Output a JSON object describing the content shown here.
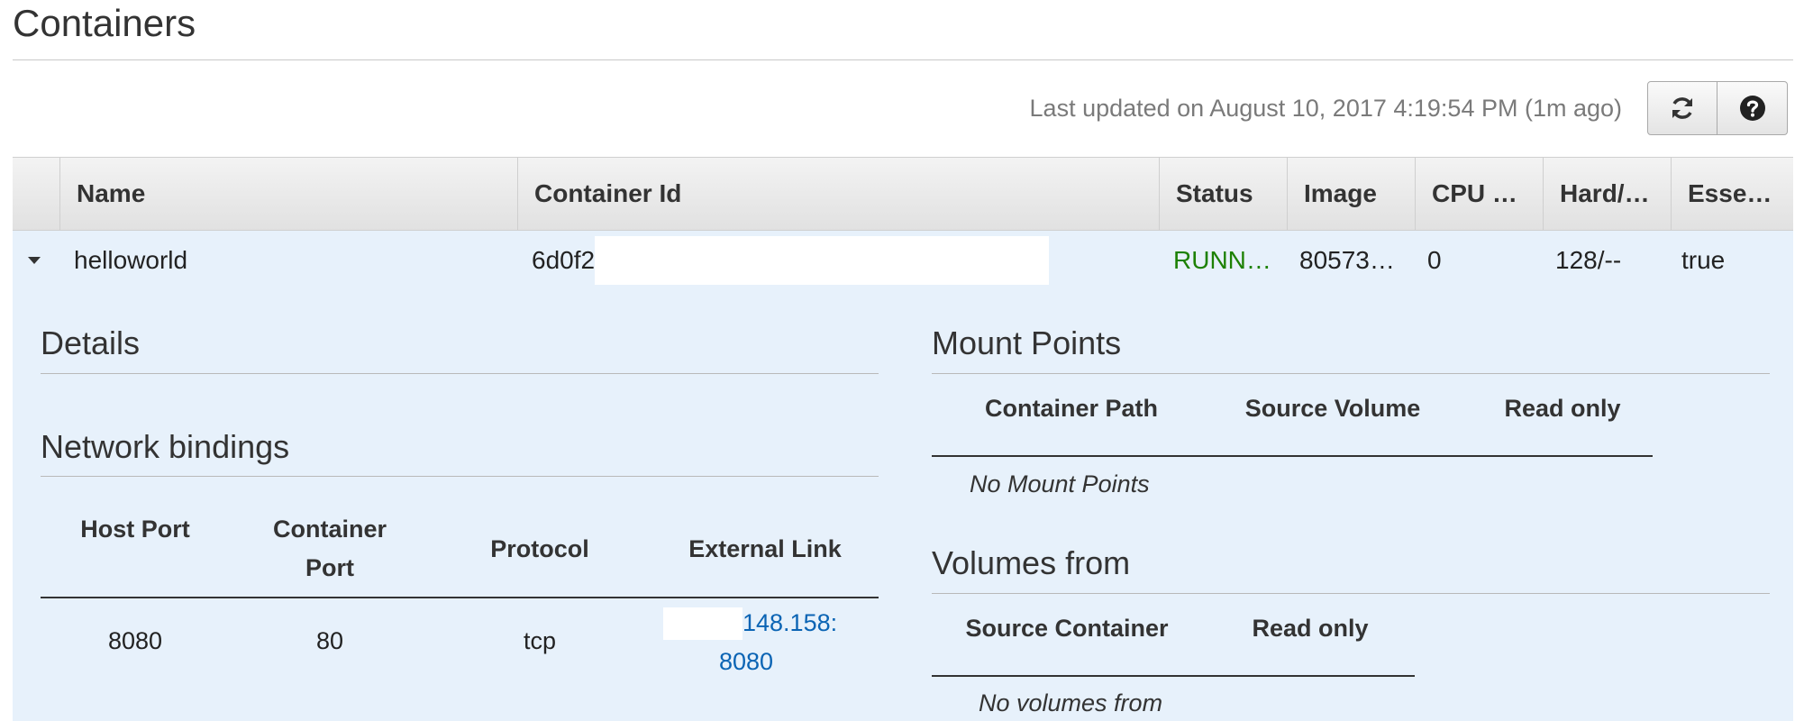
{
  "page": {
    "title": "Containers"
  },
  "toolbar": {
    "last_updated": "Last updated on August 10, 2017 4:19:54 PM (1m ago)",
    "refresh_icon": "refresh-icon",
    "help_icon": "help-icon"
  },
  "table": {
    "columns": [
      "Name",
      "Container Id",
      "Status",
      "Image",
      "CPU …",
      "Hard/…",
      "Esse…"
    ],
    "rows": [
      {
        "name": "helloworld",
        "container_id": "6d0f2",
        "status": "RUNN…",
        "image": "80573…",
        "cpu": "0",
        "memory": "128/--",
        "essential": "true"
      }
    ]
  },
  "details": {
    "title": "Details",
    "network": {
      "title": "Network bindings",
      "headers": [
        "Host Port",
        "Container Port",
        "Protocol",
        "External Link"
      ],
      "rows": [
        {
          "host_port": "8080",
          "container_port": "80",
          "protocol": "tcp",
          "external_link_line1": "148.158:",
          "external_link_line2": "8080"
        }
      ]
    },
    "mount_points": {
      "title": "Mount Points",
      "headers": [
        "Container Path",
        "Source Volume",
        "Read only"
      ],
      "empty": "No Mount Points"
    },
    "volumes_from": {
      "title": "Volumes from",
      "headers": [
        "Source Container",
        "Read only"
      ],
      "empty": "No volumes from"
    }
  },
  "colors": {
    "status_running": "#1d8102",
    "link": "#0b64b4",
    "row_bg": "#e7f1fb"
  }
}
